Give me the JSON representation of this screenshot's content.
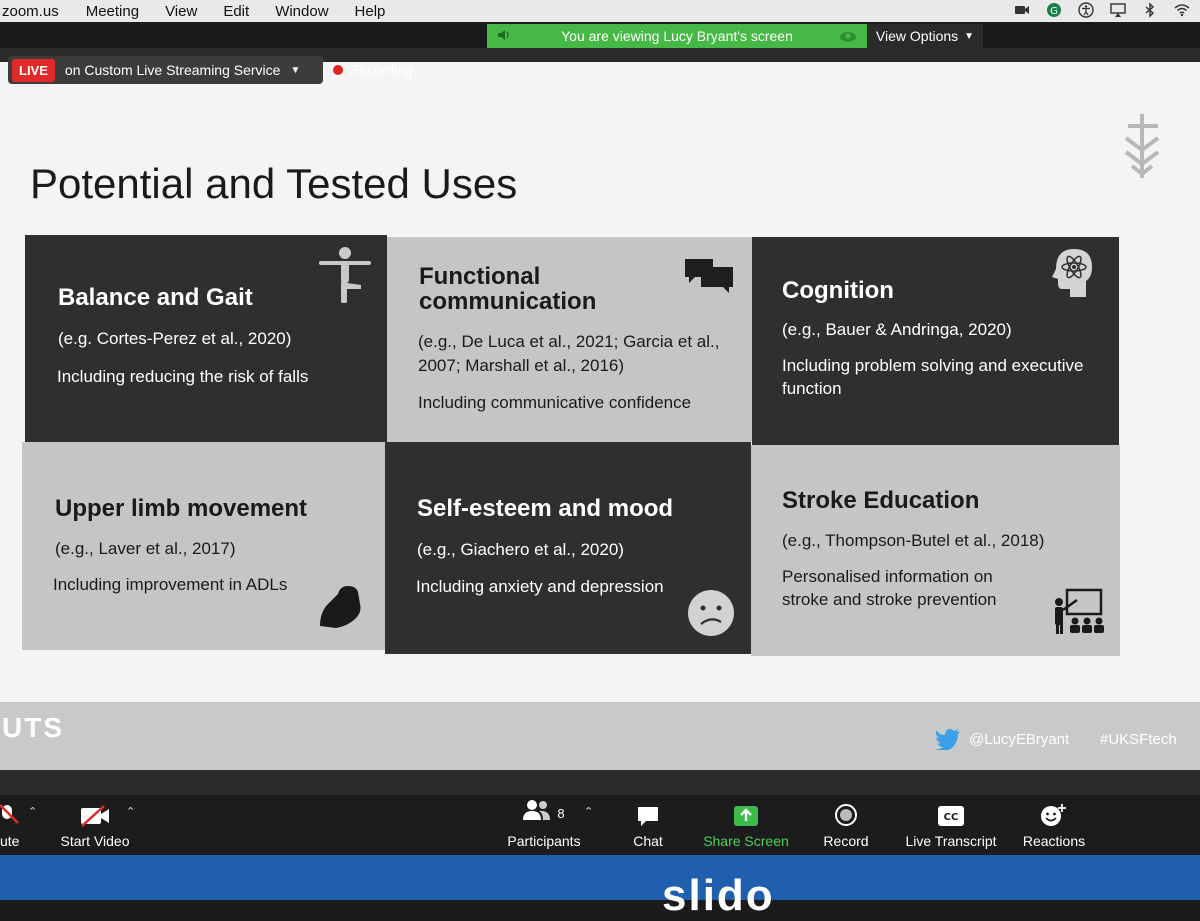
{
  "menubar": {
    "app": "zoom.us",
    "items": [
      "Meeting",
      "View",
      "Edit",
      "Window",
      "Help"
    ]
  },
  "viewing_bar": {
    "text": "You are viewing Lucy Bryant's screen",
    "options_label": "View Options"
  },
  "live": {
    "badge": "LIVE",
    "service": "on Custom Live Streaming Service",
    "recording": "Recording"
  },
  "slide": {
    "title": "Potential and Tested Uses",
    "tiles": [
      {
        "title": "Balance and Gait",
        "ref": "(e.g. Cortes-Perez et al., 2020)",
        "including": "Including reducing the risk of falls",
        "icon": "yoga-pose-icon"
      },
      {
        "title_line1": "Functional",
        "title_line2": "communication",
        "ref_line1": "(e.g., De Luca et al., 2021; Garcia et al.,",
        "ref_line2": "2007; Marshall et al., 2016)",
        "including": "Including communicative confidence",
        "icon": "speech-bubbles-icon"
      },
      {
        "title": "Cognition",
        "ref": "(e.g., Bauer & Andringa, 2020)",
        "including_line1": "Including problem solving and executive",
        "including_line2": "function",
        "icon": "brain-atom-icon"
      },
      {
        "title": "Upper limb movement",
        "ref": "(e.g., Laver et al., 2017)",
        "including": "Including improvement in ADLs",
        "icon": "flexed-arm-icon"
      },
      {
        "title": "Self-esteem and mood",
        "ref": "(e.g., Giachero et al., 2020)",
        "including": "Including anxiety and depression",
        "icon": "sad-face-icon"
      },
      {
        "title": "Stroke Education",
        "ref": "(e.g., Thompson-Butel et al., 2018)",
        "including_line1": "Personalised information on",
        "including_line2": "stroke and stroke prevention",
        "icon": "teacher-class-icon"
      }
    ],
    "footer": {
      "org": "UTS",
      "twitter": "@LucyEBryant",
      "hashtag": "#UKSFtech"
    }
  },
  "toolbar": {
    "mute": "ute",
    "start_video": "Start Video",
    "participants": "Participants",
    "participants_count": "8",
    "chat": "Chat",
    "share_screen": "Share Screen",
    "record": "Record",
    "live_transcript": "Live Transcript",
    "reactions": "Reactions"
  },
  "background_app": {
    "text": "slido"
  },
  "colors": {
    "dark_tile": "#2f2f2f",
    "light_tile": "#c5c5c5",
    "live_red": "#e22a2a",
    "viewing_green": "#46b846",
    "share_green": "#4ccf58"
  }
}
